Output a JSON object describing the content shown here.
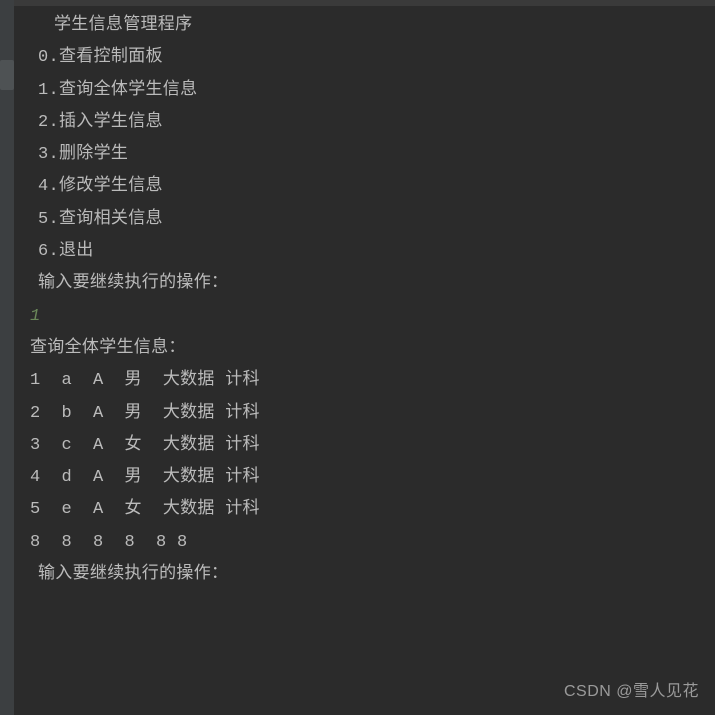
{
  "console": {
    "title": "学生信息管理程序",
    "menu": [
      "0.查看控制面板",
      "1.查询全体学生信息",
      "2.插入学生信息",
      "3.删除学生",
      "4.修改学生信息",
      "5.查询相关信息",
      "6.退出"
    ],
    "prompt": "输入要继续执行的操作：",
    "input_value": "1",
    "result_header": "查询全体学生信息：",
    "records": [
      "1  a  A  男  大数据 计科",
      "2  b  A  男  大数据 计科",
      "3  c  A  女  大数据 计科",
      "4  d  A  男  大数据 计科",
      "5  e  A  女  大数据 计科",
      "8  8  8  8  8 8"
    ],
    "prompt2": "输入要继续执行的操作："
  },
  "watermark": "CSDN @雪人见花"
}
